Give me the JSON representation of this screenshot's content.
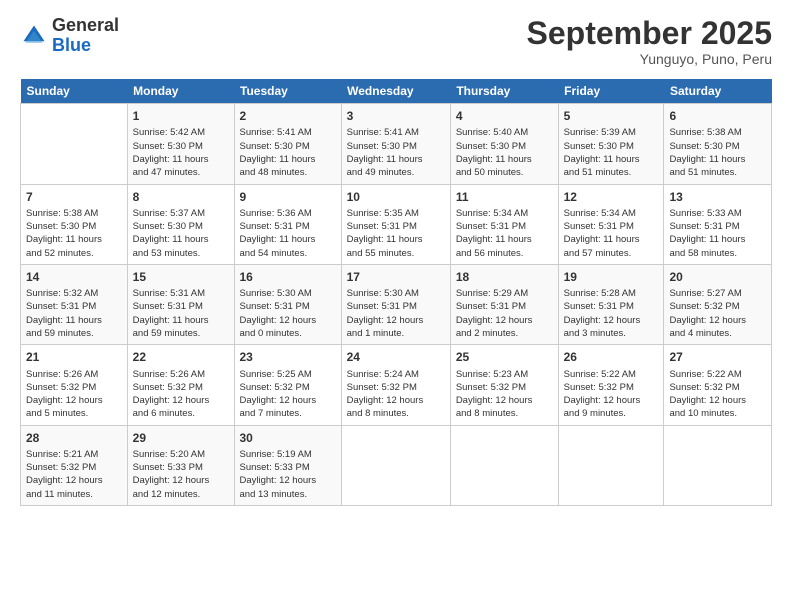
{
  "header": {
    "logo_general": "General",
    "logo_blue": "Blue",
    "month_title": "September 2025",
    "location": "Yunguyo, Puno, Peru"
  },
  "days_of_week": [
    "Sunday",
    "Monday",
    "Tuesday",
    "Wednesday",
    "Thursday",
    "Friday",
    "Saturday"
  ],
  "weeks": [
    [
      {
        "day": "",
        "info": ""
      },
      {
        "day": "1",
        "info": "Sunrise: 5:42 AM\nSunset: 5:30 PM\nDaylight: 11 hours\nand 47 minutes."
      },
      {
        "day": "2",
        "info": "Sunrise: 5:41 AM\nSunset: 5:30 PM\nDaylight: 11 hours\nand 48 minutes."
      },
      {
        "day": "3",
        "info": "Sunrise: 5:41 AM\nSunset: 5:30 PM\nDaylight: 11 hours\nand 49 minutes."
      },
      {
        "day": "4",
        "info": "Sunrise: 5:40 AM\nSunset: 5:30 PM\nDaylight: 11 hours\nand 50 minutes."
      },
      {
        "day": "5",
        "info": "Sunrise: 5:39 AM\nSunset: 5:30 PM\nDaylight: 11 hours\nand 51 minutes."
      },
      {
        "day": "6",
        "info": "Sunrise: 5:38 AM\nSunset: 5:30 PM\nDaylight: 11 hours\nand 51 minutes."
      }
    ],
    [
      {
        "day": "7",
        "info": "Sunrise: 5:38 AM\nSunset: 5:30 PM\nDaylight: 11 hours\nand 52 minutes."
      },
      {
        "day": "8",
        "info": "Sunrise: 5:37 AM\nSunset: 5:30 PM\nDaylight: 11 hours\nand 53 minutes."
      },
      {
        "day": "9",
        "info": "Sunrise: 5:36 AM\nSunset: 5:31 PM\nDaylight: 11 hours\nand 54 minutes."
      },
      {
        "day": "10",
        "info": "Sunrise: 5:35 AM\nSunset: 5:31 PM\nDaylight: 11 hours\nand 55 minutes."
      },
      {
        "day": "11",
        "info": "Sunrise: 5:34 AM\nSunset: 5:31 PM\nDaylight: 11 hours\nand 56 minutes."
      },
      {
        "day": "12",
        "info": "Sunrise: 5:34 AM\nSunset: 5:31 PM\nDaylight: 11 hours\nand 57 minutes."
      },
      {
        "day": "13",
        "info": "Sunrise: 5:33 AM\nSunset: 5:31 PM\nDaylight: 11 hours\nand 58 minutes."
      }
    ],
    [
      {
        "day": "14",
        "info": "Sunrise: 5:32 AM\nSunset: 5:31 PM\nDaylight: 11 hours\nand 59 minutes."
      },
      {
        "day": "15",
        "info": "Sunrise: 5:31 AM\nSunset: 5:31 PM\nDaylight: 11 hours\nand 59 minutes."
      },
      {
        "day": "16",
        "info": "Sunrise: 5:30 AM\nSunset: 5:31 PM\nDaylight: 12 hours\nand 0 minutes."
      },
      {
        "day": "17",
        "info": "Sunrise: 5:30 AM\nSunset: 5:31 PM\nDaylight: 12 hours\nand 1 minute."
      },
      {
        "day": "18",
        "info": "Sunrise: 5:29 AM\nSunset: 5:31 PM\nDaylight: 12 hours\nand 2 minutes."
      },
      {
        "day": "19",
        "info": "Sunrise: 5:28 AM\nSunset: 5:31 PM\nDaylight: 12 hours\nand 3 minutes."
      },
      {
        "day": "20",
        "info": "Sunrise: 5:27 AM\nSunset: 5:32 PM\nDaylight: 12 hours\nand 4 minutes."
      }
    ],
    [
      {
        "day": "21",
        "info": "Sunrise: 5:26 AM\nSunset: 5:32 PM\nDaylight: 12 hours\nand 5 minutes."
      },
      {
        "day": "22",
        "info": "Sunrise: 5:26 AM\nSunset: 5:32 PM\nDaylight: 12 hours\nand 6 minutes."
      },
      {
        "day": "23",
        "info": "Sunrise: 5:25 AM\nSunset: 5:32 PM\nDaylight: 12 hours\nand 7 minutes."
      },
      {
        "day": "24",
        "info": "Sunrise: 5:24 AM\nSunset: 5:32 PM\nDaylight: 12 hours\nand 8 minutes."
      },
      {
        "day": "25",
        "info": "Sunrise: 5:23 AM\nSunset: 5:32 PM\nDaylight: 12 hours\nand 8 minutes."
      },
      {
        "day": "26",
        "info": "Sunrise: 5:22 AM\nSunset: 5:32 PM\nDaylight: 12 hours\nand 9 minutes."
      },
      {
        "day": "27",
        "info": "Sunrise: 5:22 AM\nSunset: 5:32 PM\nDaylight: 12 hours\nand 10 minutes."
      }
    ],
    [
      {
        "day": "28",
        "info": "Sunrise: 5:21 AM\nSunset: 5:32 PM\nDaylight: 12 hours\nand 11 minutes."
      },
      {
        "day": "29",
        "info": "Sunrise: 5:20 AM\nSunset: 5:33 PM\nDaylight: 12 hours\nand 12 minutes."
      },
      {
        "day": "30",
        "info": "Sunrise: 5:19 AM\nSunset: 5:33 PM\nDaylight: 12 hours\nand 13 minutes."
      },
      {
        "day": "",
        "info": ""
      },
      {
        "day": "",
        "info": ""
      },
      {
        "day": "",
        "info": ""
      },
      {
        "day": "",
        "info": ""
      }
    ]
  ]
}
